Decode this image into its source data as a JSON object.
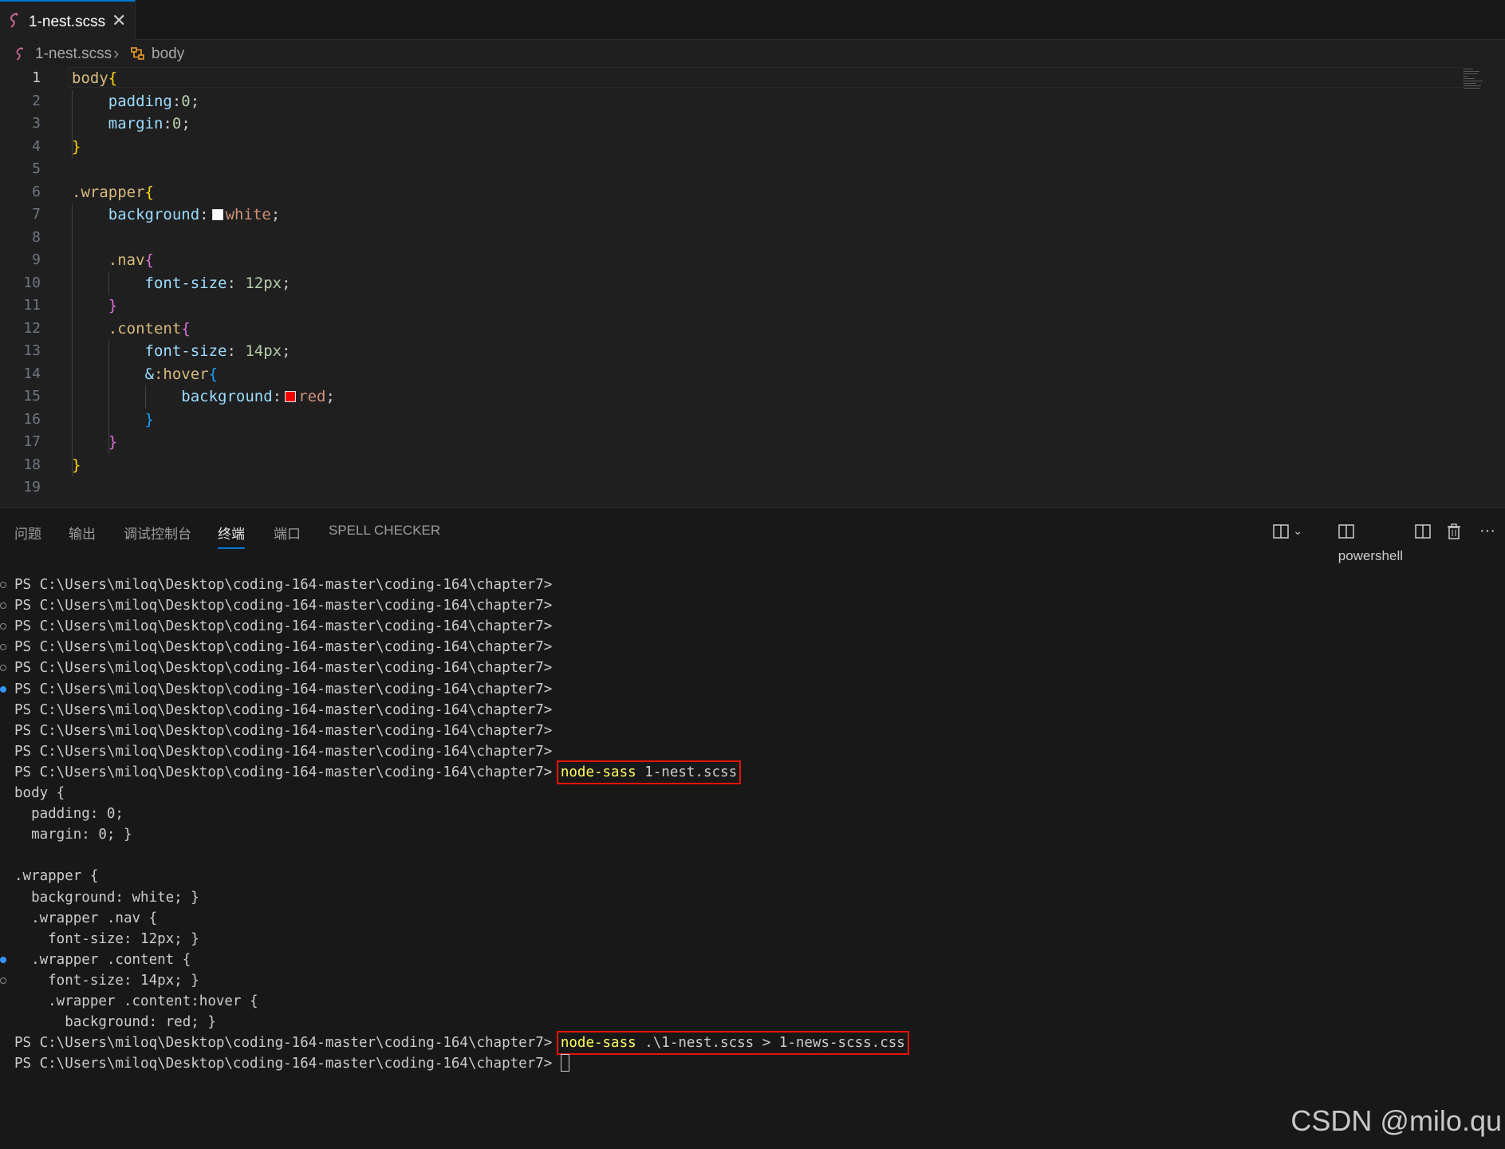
{
  "tab": {
    "label": "1-nest.scss",
    "close": "✕"
  },
  "breadcrumb": {
    "file": "1-nest.scss",
    "separator": "›",
    "symbol": "body"
  },
  "editor": {
    "lines": [
      {
        "n": "1",
        "tokens": [
          {
            "t": "body",
            "c": "tok-sel"
          },
          {
            "t": "{",
            "c": "tok-p1"
          }
        ]
      },
      {
        "n": "2",
        "tokens": [
          {
            "t": "    "
          },
          {
            "t": "padding",
            "c": "tok-prop"
          },
          {
            "t": ":"
          },
          {
            "t": "0",
            "c": "tok-num"
          },
          {
            "t": ";"
          }
        ]
      },
      {
        "n": "3",
        "tokens": [
          {
            "t": "    "
          },
          {
            "t": "margin",
            "c": "tok-prop"
          },
          {
            "t": ":"
          },
          {
            "t": "0",
            "c": "tok-num"
          },
          {
            "t": ";"
          }
        ]
      },
      {
        "n": "4",
        "tokens": [
          {
            "t": "}",
            "c": "tok-p1"
          }
        ]
      },
      {
        "n": "5",
        "tokens": []
      },
      {
        "n": "6",
        "tokens": [
          {
            "t": ".wrapper",
            "c": "tok-sel"
          },
          {
            "t": "{",
            "c": "tok-p1"
          }
        ]
      },
      {
        "n": "7",
        "tokens": [
          {
            "t": "    "
          },
          {
            "t": "background",
            "c": "tok-prop"
          },
          {
            "t": ":"
          },
          {
            "swatch": "#ffffff"
          },
          {
            "t": "white",
            "c": "tok-val"
          },
          {
            "t": ";"
          }
        ]
      },
      {
        "n": "8",
        "tokens": []
      },
      {
        "n": "9",
        "tokens": [
          {
            "t": "    "
          },
          {
            "t": ".nav",
            "c": "tok-sel"
          },
          {
            "t": "{",
            "c": "tok-p2"
          }
        ]
      },
      {
        "n": "10",
        "tokens": [
          {
            "t": "        "
          },
          {
            "t": "font-size",
            "c": "tok-prop"
          },
          {
            "t": ": "
          },
          {
            "t": "12px",
            "c": "tok-num"
          },
          {
            "t": ";"
          }
        ]
      },
      {
        "n": "11",
        "tokens": [
          {
            "t": "    "
          },
          {
            "t": "}",
            "c": "tok-p2"
          }
        ]
      },
      {
        "n": "12",
        "tokens": [
          {
            "t": "    "
          },
          {
            "t": ".content",
            "c": "tok-sel"
          },
          {
            "t": "{",
            "c": "tok-p2"
          }
        ]
      },
      {
        "n": "13",
        "tokens": [
          {
            "t": "        "
          },
          {
            "t": "font-size",
            "c": "tok-prop"
          },
          {
            "t": ": "
          },
          {
            "t": "14px",
            "c": "tok-num"
          },
          {
            "t": ";"
          }
        ]
      },
      {
        "n": "14",
        "tokens": [
          {
            "t": "        "
          },
          {
            "t": "&",
            "c": "tok-prop"
          },
          {
            "t": ":hover",
            "c": "tok-sel"
          },
          {
            "t": "{",
            "c": "tok-p3"
          }
        ]
      },
      {
        "n": "15",
        "tokens": [
          {
            "t": "            "
          },
          {
            "t": "background",
            "c": "tok-prop"
          },
          {
            "t": ":"
          },
          {
            "swatch": "#f00000"
          },
          {
            "t": "red",
            "c": "tok-val"
          },
          {
            "t": ";"
          }
        ]
      },
      {
        "n": "16",
        "tokens": [
          {
            "t": "        "
          },
          {
            "t": "}",
            "c": "tok-p3"
          }
        ]
      },
      {
        "n": "17",
        "tokens": [
          {
            "t": "    "
          },
          {
            "t": "}",
            "c": "tok-p2"
          }
        ]
      },
      {
        "n": "18",
        "tokens": [
          {
            "t": "}",
            "c": "tok-p1"
          }
        ]
      },
      {
        "n": "19",
        "tokens": []
      }
    ]
  },
  "panel": {
    "tabs": [
      {
        "label": "问题",
        "active": false
      },
      {
        "label": "输出",
        "active": false
      },
      {
        "label": "调试控制台",
        "active": false
      },
      {
        "label": "终端",
        "active": true
      },
      {
        "label": "端口",
        "active": false
      },
      {
        "label": "SPELL CHECKER",
        "active": false
      }
    ],
    "shell": "powershell",
    "more": "···"
  },
  "terminal": {
    "prompt": "PS C:\\Users\\miloq\\Desktop\\coding-164-master\\coding-164\\chapter7> ",
    "lines": [
      {
        "deco": "ok",
        "prompt": true,
        "text": ""
      },
      {
        "deco": "ok",
        "prompt": true,
        "text": ""
      },
      {
        "deco": "ok",
        "prompt": true,
        "text": ""
      },
      {
        "deco": "ok",
        "prompt": true,
        "text": ""
      },
      {
        "deco": "ok",
        "prompt": true,
        "text": ""
      },
      {
        "deco": "run",
        "prompt": true,
        "text": ""
      },
      {
        "deco": "",
        "prompt": true,
        "text": ""
      },
      {
        "deco": "",
        "prompt": true,
        "text": ""
      },
      {
        "deco": "",
        "prompt": true,
        "text": ""
      },
      {
        "deco": "",
        "prompt": true,
        "cmd": "node-sass",
        "args": " 1-nest.scss",
        "boxed": true
      },
      {
        "deco": "",
        "prompt": false,
        "text": "body {"
      },
      {
        "deco": "",
        "prompt": false,
        "text": "  padding: 0;"
      },
      {
        "deco": "",
        "prompt": false,
        "text": "  margin: 0; }"
      },
      {
        "deco": "",
        "prompt": false,
        "text": ""
      },
      {
        "deco": "",
        "prompt": false,
        "text": ".wrapper {"
      },
      {
        "deco": "",
        "prompt": false,
        "text": "  background: white; }"
      },
      {
        "deco": "",
        "prompt": false,
        "text": "  .wrapper .nav {"
      },
      {
        "deco": "",
        "prompt": false,
        "text": "    font-size: 12px; }"
      },
      {
        "deco": "run",
        "prompt": false,
        "text": "  .wrapper .content {"
      },
      {
        "deco": "ok",
        "prompt": false,
        "text": "    font-size: 14px; }"
      },
      {
        "deco": "",
        "prompt": false,
        "text": "    .wrapper .content:hover {"
      },
      {
        "deco": "",
        "prompt": false,
        "text": "      background: red; }"
      },
      {
        "deco": "",
        "prompt": true,
        "cmd": "node-sass",
        "args": " .\\1-nest.scss > 1-news-scss.css",
        "boxed": true
      },
      {
        "deco": "",
        "prompt": true,
        "text": "",
        "cursor": true
      }
    ]
  },
  "watermark": "CSDN @milo.qu"
}
